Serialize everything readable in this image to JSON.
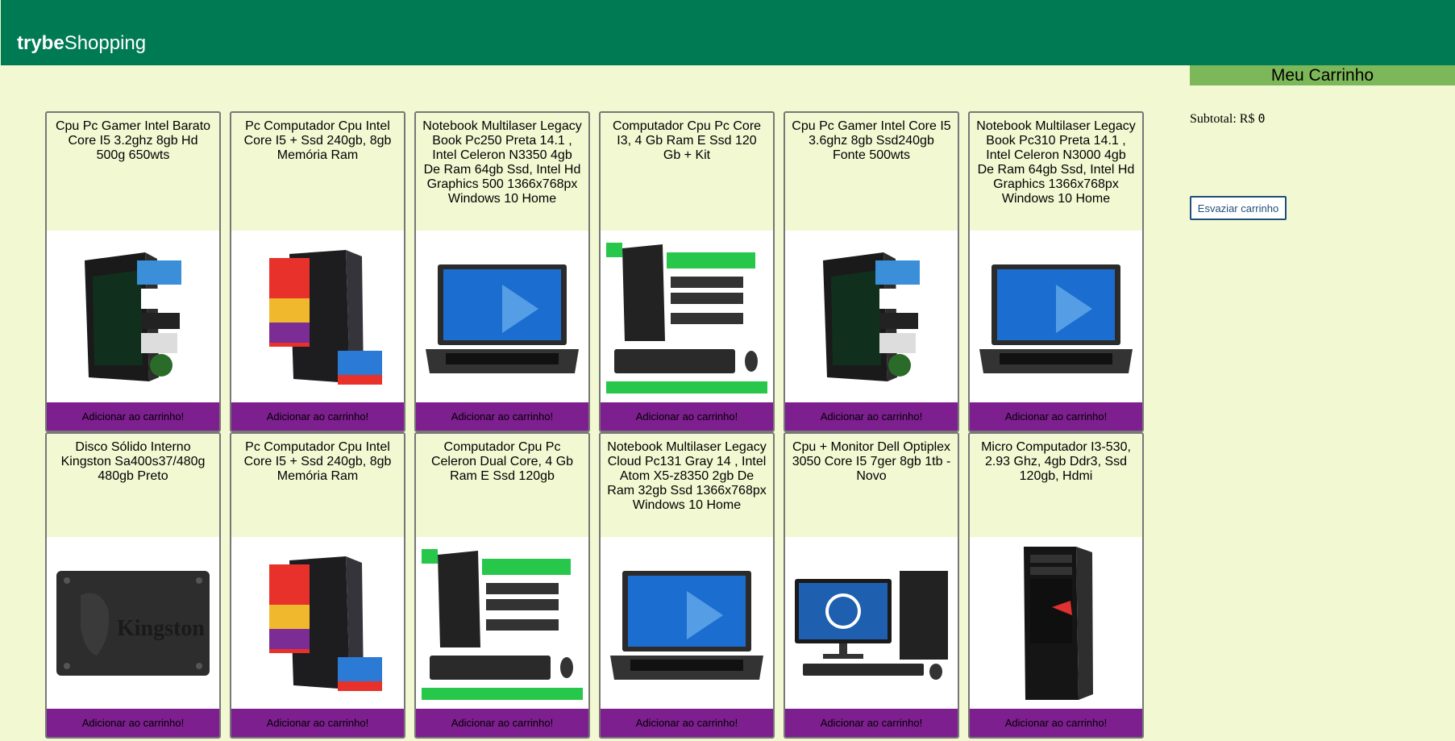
{
  "header": {
    "logo_bold": "trybe",
    "logo_rest": "Shopping"
  },
  "cart": {
    "title": "Meu Carrinho",
    "subtotal_label": "Subtotal: R$",
    "subtotal_value": "0",
    "empty_label": "Esvaziar carrinho"
  },
  "add_label": "Adicionar ao carrinho!",
  "products": [
    {
      "title": "Cpu Pc Gamer Intel Barato Core I5 3.2ghz 8gb Hd 500g 650wts",
      "image": "gamer-tower-icon"
    },
    {
      "title": "Pc Computador Cpu Intel Core I5 + Ssd 240gb, 8gb Memória Ram",
      "image": "promo-tower-icon"
    },
    {
      "title": "Notebook Multilaser Legacy Book Pc250 Preta 14.1 , Intel Celeron N3350 4gb De Ram 64gb Ssd, Intel Hd Graphics 500 1366x768px Windows 10 Home",
      "image": "laptop-icon"
    },
    {
      "title": "Computador Cpu Pc Core I3, 4 Gb Ram E Ssd 120 Gb + Kit",
      "image": "tower-kit-icon"
    },
    {
      "title": "Cpu Pc Gamer Intel Core I5 3.6ghz 8gb Ssd240gb Fonte 500wts",
      "image": "gamer-tower-icon"
    },
    {
      "title": "Notebook Multilaser Legacy Book Pc310 Preta 14.1 , Intel Celeron N3000 4gb De Ram 64gb Ssd, Intel Hd Graphics 1366x768px Windows 10 Home",
      "image": "laptop-icon"
    },
    {
      "title": "Disco Sólido Interno Kingston Sa400s37/480g 480gb Preto",
      "image": "ssd-icon"
    },
    {
      "title": "Pc Computador Cpu Intel Core I5 + Ssd 240gb, 8gb Memória Ram",
      "image": "promo-tower-icon"
    },
    {
      "title": "Computador Cpu Pc Celeron Dual Core, 4 Gb Ram E Ssd 120gb",
      "image": "tower-kit-icon"
    },
    {
      "title": "Notebook Multilaser Legacy Cloud Pc131 Gray 14 , Intel Atom X5-z8350 2gb De Ram 32gb Ssd 1366x768px Windows 10 Home",
      "image": "laptop-icon"
    },
    {
      "title": "Cpu + Monitor Dell Optiplex 3050 Core I5 7ger 8gb 1tb - Novo",
      "image": "desktop-monitor-icon"
    },
    {
      "title": "Micro Computador I3-530, 2.93 Ghz, 4gb Ddr3, Ssd 120gb, Hdmi",
      "image": "tower-icon"
    }
  ]
}
